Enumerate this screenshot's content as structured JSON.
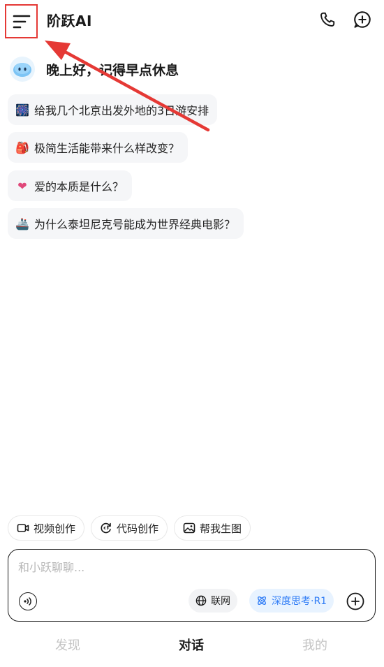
{
  "header": {
    "title": "阶跃AI",
    "menu_icon": "hamburger-menu-icon",
    "phone_icon": "phone-icon",
    "new_chat_icon": "new-chat-plus-icon"
  },
  "greeting": {
    "text": "晚上好，记得早点休息",
    "avatar_icon": "mascot-avatar-icon"
  },
  "suggestions": [
    {
      "emoji": "🎆",
      "text": "给我几个北京出发外地的3日游安排"
    },
    {
      "emoji": "🎒",
      "text": "极简生活能带来什么样改变？"
    },
    {
      "emoji": "❤",
      "text": "爱的本质是什么？"
    },
    {
      "emoji": "🚢",
      "text": "为什么泰坦尼克号能成为世界经典电影？"
    }
  ],
  "tools": [
    {
      "label": "视频创作",
      "icon": "video-camera-icon"
    },
    {
      "label": "代码创作",
      "icon": "code-refresh-icon"
    },
    {
      "label": "帮我生图",
      "icon": "image-icon"
    }
  ],
  "input": {
    "placeholder": "和小跃聊聊...",
    "value": "",
    "web_label": "联网",
    "deep_label": "深度思考·R1"
  },
  "tabs": [
    {
      "label": "发现",
      "active": false
    },
    {
      "label": "对话",
      "active": true
    },
    {
      "label": "我的",
      "active": false
    }
  ],
  "colors": {
    "accent_blue": "#2f7cf6",
    "annotation_red": "#e53935"
  }
}
